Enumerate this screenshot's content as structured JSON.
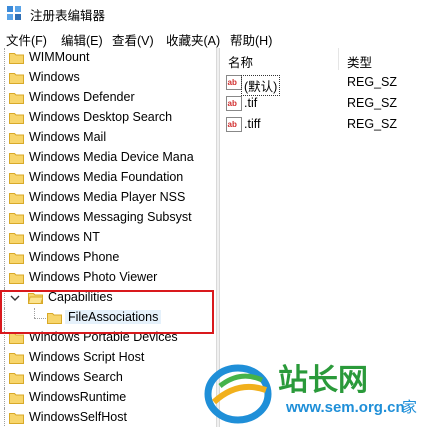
{
  "window": {
    "title": "注册表编辑器"
  },
  "menu": [
    "文件(F)",
    "编辑(E)",
    "查看(V)",
    "收藏夹(A)",
    "帮助(H)"
  ],
  "tree": [
    {
      "label": "WIMMount"
    },
    {
      "label": "Windows"
    },
    {
      "label": "Windows Defender"
    },
    {
      "label": "Windows Desktop Search"
    },
    {
      "label": "Windows Mail"
    },
    {
      "label": "Windows Media Device Mana"
    },
    {
      "label": "Windows Media Foundation"
    },
    {
      "label": "Windows Media Player NSS"
    },
    {
      "label": "Windows Messaging Subsyst"
    },
    {
      "label": "Windows NT"
    },
    {
      "label": "Windows Phone"
    },
    {
      "label": "Windows Photo Viewer"
    },
    {
      "label": "Capabilities",
      "expanded": true
    },
    {
      "label": "FileAssociations",
      "selected": true
    },
    {
      "label": "Windows Portable Devices"
    },
    {
      "label": "Windows Script Host"
    },
    {
      "label": "Windows Search"
    },
    {
      "label": "WindowsRuntime"
    },
    {
      "label": "WindowsSelfHost"
    }
  ],
  "list": {
    "columns": [
      "名称",
      "类型"
    ],
    "rows": [
      {
        "name": "(默认)",
        "type": "REG_SZ",
        "focused": true,
        "icon": "string-value-icon"
      },
      {
        "name": ".tif",
        "type": "REG_SZ",
        "icon": "string-value-icon"
      },
      {
        "name": ".tiff",
        "type": "REG_SZ",
        "icon": "string-value-icon"
      }
    ]
  },
  "watermark": {
    "brand": "站长网",
    "url": "www.sem.org.cn",
    "suffix": "家"
  },
  "colors": {
    "highlight_border": "#d9191d",
    "folder": "#f7d56b",
    "selection": "#e5f1fb"
  }
}
